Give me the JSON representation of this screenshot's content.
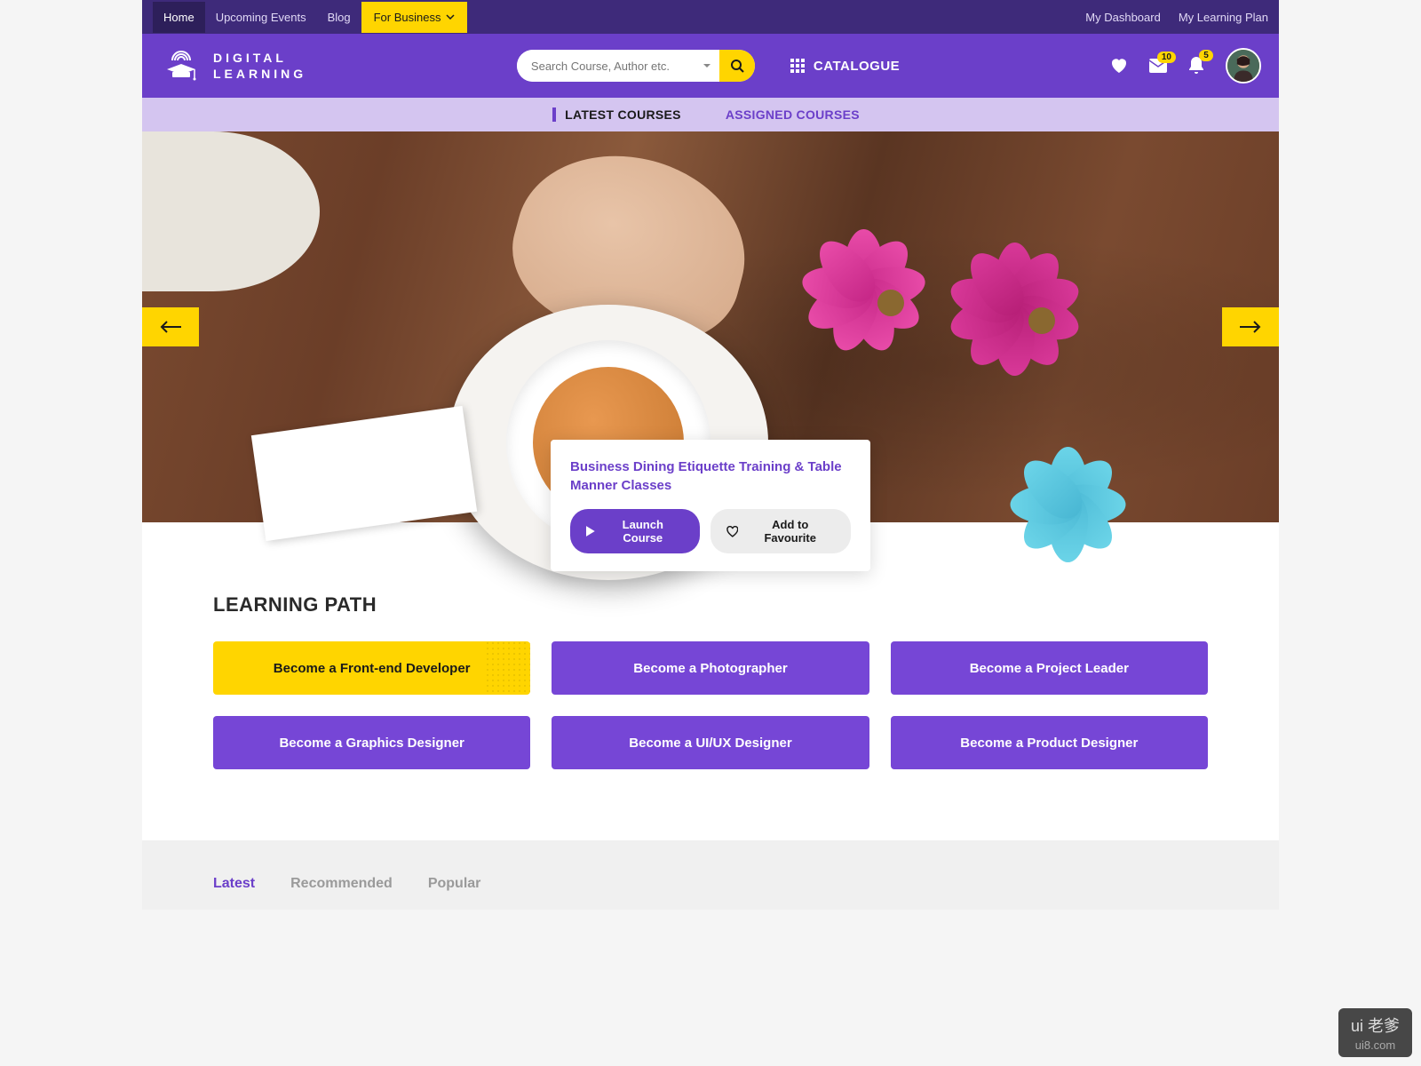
{
  "topnav": {
    "items": [
      {
        "label": "Home",
        "active": true
      },
      {
        "label": "Upcoming Events",
        "active": false
      },
      {
        "label": "Blog",
        "active": false
      }
    ],
    "business_label": "For Business",
    "right": [
      {
        "label": "My Dashboard"
      },
      {
        "label": "My Learning Plan"
      }
    ]
  },
  "header": {
    "logo_line1": "DIGITAL",
    "logo_line2": "LEARNING",
    "search_placeholder": "Search Course, Author etc.",
    "catalogue_label": "CATALOGUE",
    "messages_badge": "10",
    "notifications_badge": "5"
  },
  "tabs": [
    {
      "label": "LATEST COURSES",
      "active": true
    },
    {
      "label": "ASSIGNED COURSES",
      "active": false
    }
  ],
  "hero": {
    "title": "Business Dining Etiquette Training & Table Manner Classes",
    "launch_label": "Launch Course",
    "favourite_label": "Add to Favourite"
  },
  "learning_path": {
    "title": "LEARNING PATH",
    "items": [
      {
        "label": "Become a Front-end Developer",
        "highlight": true
      },
      {
        "label": "Become a Photographer",
        "highlight": false
      },
      {
        "label": "Become a Project Leader",
        "highlight": false
      },
      {
        "label": "Become a Graphics Designer",
        "highlight": false
      },
      {
        "label": "Become a UI/UX Designer",
        "highlight": false
      },
      {
        "label": "Become a Product Designer",
        "highlight": false
      }
    ]
  },
  "bottom_tabs": [
    {
      "label": "Latest",
      "active": true
    },
    {
      "label": "Recommended",
      "active": false
    },
    {
      "label": "Popular",
      "active": false
    }
  ],
  "watermark": {
    "logo": "ui 老爹",
    "url": "ui8.com"
  }
}
